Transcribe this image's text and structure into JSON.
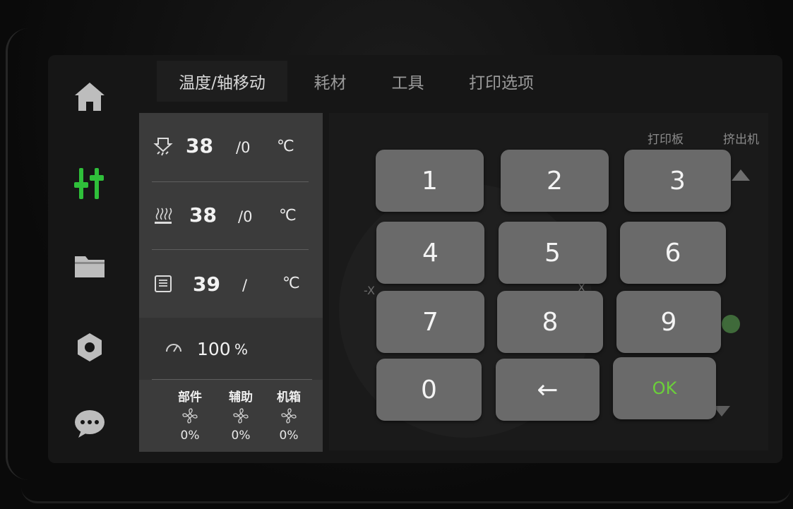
{
  "tabs": [
    {
      "label": "温度/轴移动",
      "active": true
    },
    {
      "label": "耗材",
      "active": false
    },
    {
      "label": "工具",
      "active": false
    },
    {
      "label": "打印选项",
      "active": false
    }
  ],
  "sidebar": {
    "items": [
      {
        "icon": "home-icon",
        "active": false
      },
      {
        "icon": "sliders-icon",
        "active": true
      },
      {
        "icon": "folder-icon",
        "active": false
      },
      {
        "icon": "settings-icon",
        "active": false
      },
      {
        "icon": "chat-icon",
        "active": false
      }
    ],
    "active_color": "#2fbf3a"
  },
  "status": {
    "nozzle": {
      "current": "38",
      "target": "/0",
      "unit": "℃"
    },
    "bed": {
      "current": "38",
      "target": "/0",
      "unit": "℃"
    },
    "chamber": {
      "current": "39",
      "target": "/",
      "unit": "℃"
    },
    "speed": {
      "value": "100",
      "unit": "%"
    },
    "fans": [
      {
        "label": "部件",
        "value": "0%"
      },
      {
        "label": "辅助",
        "value": "0%"
      },
      {
        "label": "机箱",
        "value": "0%"
      }
    ]
  },
  "move_panel": {
    "bed_label": "打印板",
    "extruder_label": "挤出机",
    "axis_minus_x": "-X",
    "axis_x": "X"
  },
  "keypad": {
    "keys": [
      "1",
      "2",
      "3",
      "4",
      "5",
      "6",
      "7",
      "8",
      "9",
      "0",
      "←",
      "OK"
    ],
    "ok_color": "#6bd03a"
  }
}
